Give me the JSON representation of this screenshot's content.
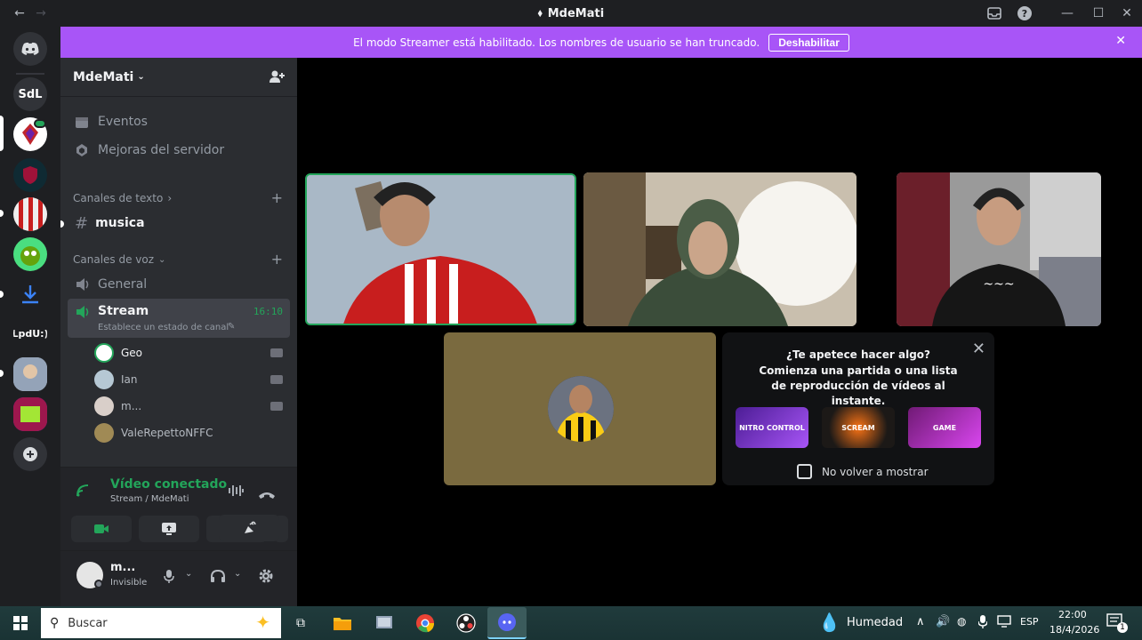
{
  "window": {
    "title": "MdeMati"
  },
  "banner": {
    "text": "El modo Streamer está habilitado. Los nombres de usuario se han truncado.",
    "button": "Deshabilitar"
  },
  "rail": {
    "servers": [
      {
        "label": "SdL"
      },
      {
        "label": "LpdU:)"
      }
    ]
  },
  "server": {
    "name": "MdeMati",
    "menu": {
      "events": "Eventos",
      "boosts": "Mejoras del servidor"
    },
    "text_category": "Canales de texto",
    "text_channels": [
      {
        "name": "musica"
      }
    ],
    "voice_category": "Canales de voz",
    "voice_channels": [
      {
        "name": "General"
      },
      {
        "name": "Stream",
        "timer": "16:10",
        "status": "Establece un estado de canal"
      }
    ],
    "members": [
      {
        "name": "Geo"
      },
      {
        "name": "Ian"
      },
      {
        "name": "m..."
      },
      {
        "name": "ValeRepettoNFFC"
      }
    ]
  },
  "voice_panel": {
    "title": "Vídeo conectado",
    "subtitle": "Stream / MdeMati"
  },
  "user": {
    "name": "m...",
    "status": "Invisible"
  },
  "activity_popup": {
    "title": "¿Te apetece hacer algo?",
    "body": "Comienza una partida o una lista de reproducción de vídeos al instante.",
    "games": [
      {
        "label": "NITRO CONTROL",
        "color": "#7c3aed"
      },
      {
        "label": "SCREAM",
        "color": "#b45309"
      },
      {
        "label": "GAME",
        "color": "#a21caf"
      }
    ],
    "checkbox": "No volver a mostrar"
  },
  "taskbar": {
    "search_placeholder": "Buscar",
    "weather": "Humedad",
    "lang": "ESP",
    "time": "22:00",
    "date": "18/4/2026",
    "notif": "1"
  },
  "colors": {
    "accent": "#a855f7",
    "green": "#23a55a",
    "blurple": "#5865f2"
  }
}
